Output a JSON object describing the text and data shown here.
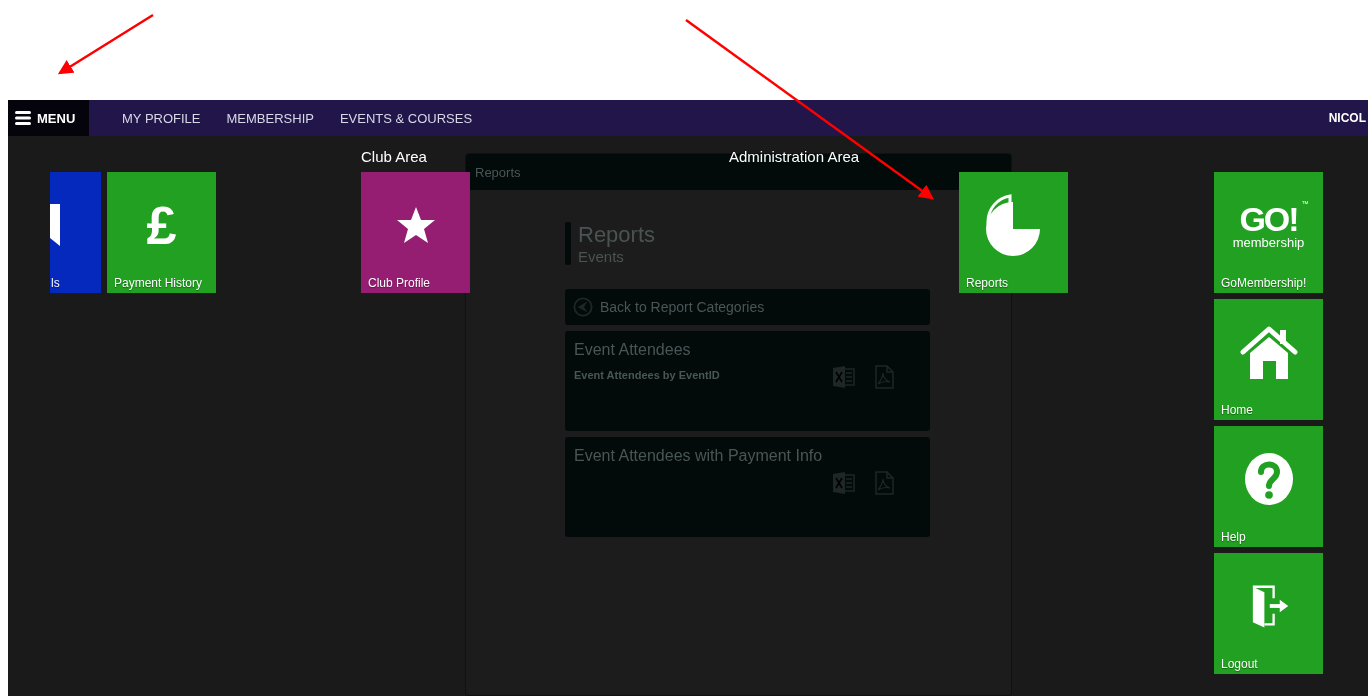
{
  "nav": {
    "menu_label": "MENU",
    "links": [
      "MY PROFILE",
      "MEMBERSHIP",
      "EVENTS & COURSES"
    ],
    "user": "NICOL"
  },
  "background_page": {
    "header": "Reports",
    "title": "Reports",
    "subtitle": "Events",
    "back_button": "Back to Report Categories",
    "reports": [
      {
        "title": "Event Attendees",
        "description": "Event Attendees by EventID"
      },
      {
        "title": "Event Attendees with Payment Info"
      }
    ]
  },
  "menu": {
    "sections": [
      {
        "kind": "personal",
        "tiles": [
          {
            "label": "ls",
            "kind": "partial",
            "color": "#0529bd"
          },
          {
            "label": "Payment History",
            "kind": "pound",
            "glyph": "£",
            "color": "#21a021"
          }
        ]
      },
      {
        "kind": "club",
        "heading": "Club Area",
        "tiles": [
          {
            "label": "Club Profile",
            "kind": "star",
            "color": "#951e73"
          }
        ]
      },
      {
        "kind": "admin",
        "heading": "Administration Area",
        "tiles": [
          {
            "label": "Reports",
            "kind": "pie",
            "color": "#21a021"
          }
        ]
      },
      {
        "kind": "general",
        "tiles": [
          {
            "label": "GoMembership!",
            "kind": "logo",
            "logo": {
              "main": "GO!",
              "sub": "membership",
              "mark": "™"
            },
            "color": "#21a021"
          },
          {
            "label": "Home",
            "kind": "house",
            "color": "#21a021"
          },
          {
            "label": "Help",
            "kind": "question",
            "color": "#21a021"
          },
          {
            "label": "Logout",
            "kind": "door",
            "color": "#21a021"
          }
        ]
      }
    ]
  }
}
